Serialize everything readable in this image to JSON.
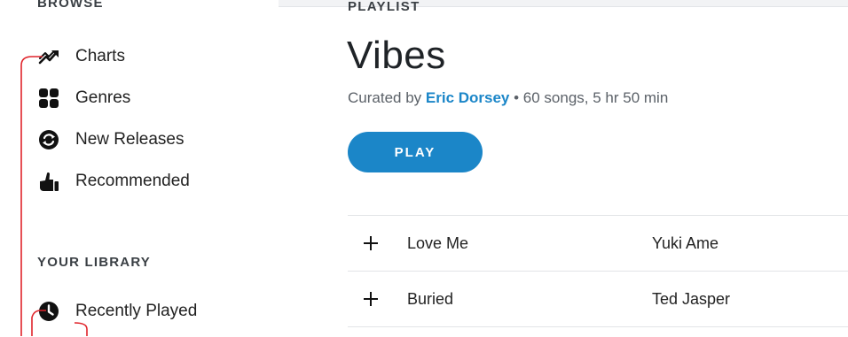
{
  "sidebar": {
    "browse_title": "BROWSE",
    "browse_items": [
      {
        "label": "Charts",
        "icon": "chart-trend-icon"
      },
      {
        "label": "Genres",
        "icon": "grid-icon"
      },
      {
        "label": "New Releases",
        "icon": "refresh-circle-icon"
      },
      {
        "label": "Recommended",
        "icon": "thumbs-up-icon"
      }
    ],
    "library_title": "YOUR LIBRARY",
    "library_items": [
      {
        "label": "Recently Played",
        "icon": "clock-icon"
      }
    ]
  },
  "playlist": {
    "eyebrow": "PLAYLIST",
    "title": "Vibes",
    "curated_prefix": "Curated by ",
    "curator": "Eric Dorsey",
    "stats": " • 60 songs, 5 hr 50 min",
    "play_label": "PLAY"
  },
  "tracks": [
    {
      "title": "Love Me",
      "artist": "Yuki Ame"
    },
    {
      "title": "Buried",
      "artist": "Ted Jasper"
    }
  ],
  "colors": {
    "accent": "#1b86c8",
    "annotation": "#e0242b",
    "main_bg": "#f2f3f5"
  }
}
